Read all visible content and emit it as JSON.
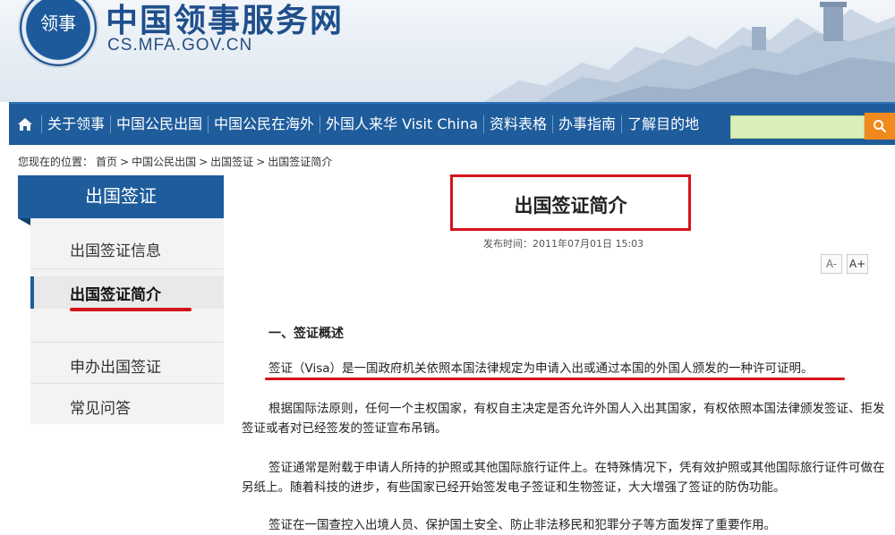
{
  "header": {
    "emblem_text": "领事",
    "site_title": "中国领事服务网",
    "site_url": "CS.MFA.GOV.CN"
  },
  "nav": {
    "items": [
      "关于领事",
      "中国公民出国",
      "中国公民在海外",
      "外国人来华 Visit China",
      "资料表格",
      "办事指南",
      "了解目的地"
    ],
    "search_placeholder": "",
    "colors": {
      "nav_bg": "#1e5c9c",
      "search_btn": "#f08a1c"
    }
  },
  "breadcrumb": {
    "prefix": "您现在的位置：",
    "items": [
      "首页",
      "中国公民出国",
      "出国签证",
      "出国签证简介"
    ],
    "separator": ">"
  },
  "sidebar": {
    "header": "出国签证",
    "items": [
      "出国签证信息",
      "出国签证简介",
      "申办出国签证",
      "常见问答"
    ],
    "active_index": 1
  },
  "article": {
    "title": "出国签证简介",
    "publish_time": "发布时间：2011年07月01日 15:03",
    "font_smaller": "A-",
    "font_larger": "A+",
    "section_heading": "一、签证概述",
    "paragraphs": [
      "签证（Visa）是一国政府机关依照本国法律规定为申请入出或通过本国的外国人颁发的一种许可证明。",
      "根据国际法原则，任何一个主权国家，有权自主决定是否允许外国人入出其国家，有权依照本国法律颁发签证、拒发签证或者对已经签发的签证宣布吊销。",
      "签证通常是附载于申请人所持的护照或其他国际旅行证件上。在特殊情况下，凭有效护照或其他国际旅行证件可做在另纸上。随着科技的进步，有些国家已经开始签发电子签证和生物签证，大大增强了签证的防伪功能。",
      "签证在一国查控入出境人员、保护国土安全、防止非法移民和犯罪分子等方面发挥了重要作用。"
    ]
  },
  "annotation_color": "#d4131b"
}
